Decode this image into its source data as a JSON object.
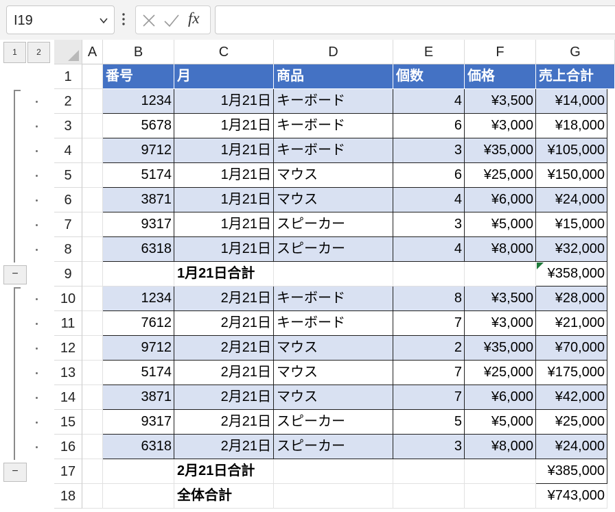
{
  "name_box": {
    "value": "I19"
  },
  "outline": {
    "levels": [
      "1",
      "2"
    ],
    "collapse_symbol": "−"
  },
  "columns": [
    "A",
    "B",
    "C",
    "D",
    "E",
    "F",
    "G"
  ],
  "headers": [
    "番号",
    "月",
    "商品",
    "個数",
    "価格",
    "売上合計"
  ],
  "rows": [
    {
      "row": "1"
    },
    {
      "row": "2",
      "id": "1234",
      "date": "1月21日",
      "product": "キーボード",
      "qty": "4",
      "price": "¥3,500",
      "total": "¥14,000"
    },
    {
      "row": "3",
      "id": "5678",
      "date": "1月21日",
      "product": "キーボード",
      "qty": "6",
      "price": "¥3,000",
      "total": "¥18,000"
    },
    {
      "row": "4",
      "id": "9712",
      "date": "1月21日",
      "product": "キーボード",
      "qty": "3",
      "price": "¥35,000",
      "total": "¥105,000"
    },
    {
      "row": "5",
      "id": "5174",
      "date": "1月21日",
      "product": "マウス",
      "qty": "6",
      "price": "¥25,000",
      "total": "¥150,000"
    },
    {
      "row": "6",
      "id": "3871",
      "date": "1月21日",
      "product": "マウス",
      "qty": "4",
      "price": "¥6,000",
      "total": "¥24,000"
    },
    {
      "row": "7",
      "id": "9317",
      "date": "1月21日",
      "product": "スピーカー",
      "qty": "3",
      "price": "¥5,000",
      "total": "¥15,000"
    },
    {
      "row": "8",
      "id": "6318",
      "date": "1月21日",
      "product": "スピーカー",
      "qty": "4",
      "price": "¥8,000",
      "total": "¥32,000"
    },
    {
      "row": "9",
      "date": "1月21日合計",
      "total": "¥358,000"
    },
    {
      "row": "10",
      "id": "1234",
      "date": "2月21日",
      "product": "キーボード",
      "qty": "8",
      "price": "¥3,500",
      "total": "¥28,000"
    },
    {
      "row": "11",
      "id": "7612",
      "date": "2月21日",
      "product": "キーボード",
      "qty": "7",
      "price": "¥3,000",
      "total": "¥21,000"
    },
    {
      "row": "12",
      "id": "9712",
      "date": "2月21日",
      "product": "マウス",
      "qty": "2",
      "price": "¥35,000",
      "total": "¥70,000"
    },
    {
      "row": "13",
      "id": "5174",
      "date": "2月21日",
      "product": "マウス",
      "qty": "7",
      "price": "¥25,000",
      "total": "¥175,000"
    },
    {
      "row": "14",
      "id": "3871",
      "date": "2月21日",
      "product": "マウス",
      "qty": "7",
      "price": "¥6,000",
      "total": "¥42,000"
    },
    {
      "row": "15",
      "id": "9317",
      "date": "2月21日",
      "product": "スピーカー",
      "qty": "5",
      "price": "¥5,000",
      "total": "¥25,000"
    },
    {
      "row": "16",
      "id": "6318",
      "date": "2月21日",
      "product": "スピーカー",
      "qty": "3",
      "price": "¥8,000",
      "total": "¥24,000"
    },
    {
      "row": "17",
      "date": "2月21日合計",
      "total": "¥385,000"
    },
    {
      "row": "18",
      "date": "全体合計",
      "total": "¥743,000"
    }
  ],
  "colors": {
    "header_fill": "#4472c4",
    "band_fill": "#d9e1f2",
    "error_indicator": "#1e7a3b"
  }
}
